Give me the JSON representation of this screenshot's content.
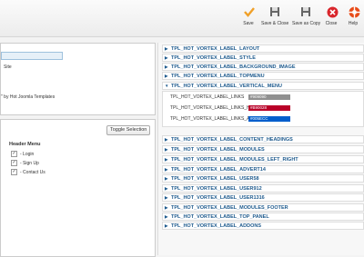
{
  "toolbar": {
    "buttons": [
      {
        "label": "Save",
        "icon": "check-icon",
        "color": "#f0a028"
      },
      {
        "label": "Save & Close",
        "icon": "save-close-icon",
        "color": "#555555"
      },
      {
        "label": "Save as Copy",
        "icon": "save-copy-icon",
        "color": "#555555"
      },
      {
        "label": "Close",
        "icon": "close-icon",
        "color": "#d9262c"
      },
      {
        "label": "Help",
        "icon": "help-icon",
        "color": "#e84b18"
      }
    ]
  },
  "left_top": {
    "site_label": "Site",
    "credit_text": "\" by Hot Joomla Templates"
  },
  "left_bottom": {
    "toggle_label": "Toggle Selection",
    "menu_heading": "Header Menu",
    "items": [
      "- Login",
      "- Sign Up",
      "- Contact Us"
    ]
  },
  "accordion": {
    "sections_top": [
      "TPL_HOT_VORTEX_LABEL_LAYOUT",
      "TPL_HOT_VORTEX_LABEL_STYLE",
      "TPL_HOT_VORTEX_LABEL_BACKGROUND_IMAGE",
      "TPL_HOT_VORTEX_LABEL_TOPMENU",
      "TPL_HOT_VORTEX_LABEL_VERTICAL_MENU"
    ],
    "vertical_menu": {
      "rows": [
        {
          "label": "TPL_HOT_VORTEX_LABEL_LINKS",
          "value": "#909090",
          "color": "#909090"
        },
        {
          "label": "TPL_HOT_VORTEX_LABEL_LINKS_HOVER",
          "value": "#B90028",
          "color": "#b90028"
        },
        {
          "label": "TPL_HOT_VORTEX_LABEL_LINKS_ACTIVE",
          "value": "#005ECC",
          "color": "#005ecc"
        }
      ]
    },
    "sections_bottom": [
      "TPL_HOT_VORTEX_LABEL_CONTENT_HEADINGS",
      "TPL_HOT_VORTEX_LABEL_MODULES",
      "TPL_HOT_VORTEX_LABEL_MODULES_LEFT_RIGHT",
      "TPL_HOT_VORTEX_LABEL_ADVERT14",
      "TPL_HOT_VORTEX_LABEL_USER58",
      "TPL_HOT_VORTEX_LABEL_USER912",
      "TPL_HOT_VORTEX_LABEL_USER1316",
      "TPL_HOT_VORTEX_LABEL_MODULES_FOOTER",
      "TPL_HOT_VORTEX_LABEL_TOP_PANEL",
      "TPL_HOT_VORTEX_LABEL_ADDONS"
    ]
  }
}
